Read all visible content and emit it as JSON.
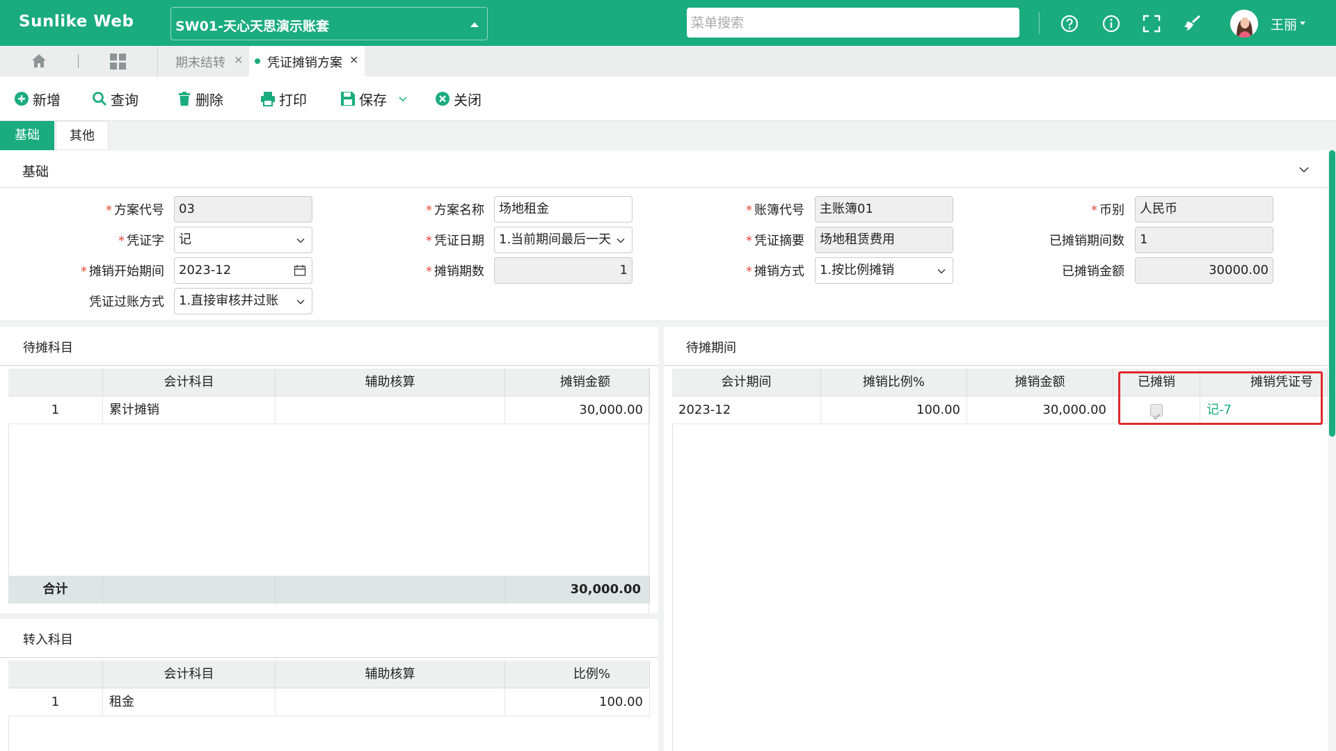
{
  "header": {
    "brand": "Sunlike Web",
    "account": "SW01-天心天思演示账套",
    "search_placeholder": "菜单搜索",
    "user": "王丽"
  },
  "tabs": {
    "inactive": "期末结转",
    "active": "凭证摊销方案",
    "close": "×"
  },
  "toolbar": {
    "add": "新增",
    "query": "查询",
    "delete": "删除",
    "print": "打印",
    "save": "保存",
    "close": "关闭"
  },
  "subtabs": {
    "basic": "基础",
    "other": "其他"
  },
  "section": {
    "title": "基础"
  },
  "form": {
    "scheme_code_label": "方案代号",
    "scheme_code": "03",
    "scheme_name_label": "方案名称",
    "scheme_name": "场地租金",
    "book_code_label": "账簿代号",
    "book_code": "主账簿01",
    "currency_label": "币别",
    "currency": "人民币",
    "voucher_word_label": "凭证字",
    "voucher_word": "记",
    "voucher_date_label": "凭证日期",
    "voucher_date": "1.当前期间最后一天",
    "voucher_summary_label": "凭证摘要",
    "voucher_summary": "场地租赁费用",
    "amortized_periods_label": "已摊销期间数",
    "amortized_periods": "1",
    "start_period_label": "摊销开始期间",
    "start_period": "2023-12",
    "period_count_label": "摊销期数",
    "period_count": "1",
    "method_label": "摊销方式",
    "method": "1.按比例摊销",
    "amortized_amount_label": "已摊销金额",
    "amortized_amount": "30000.00",
    "posting_label": "凭证过账方式",
    "posting": "1.直接审核并过账"
  },
  "pending_accounts": {
    "title": "待摊科目",
    "columns": [
      "会计科目",
      "辅助核算",
      "摊销金额"
    ],
    "rows": [
      {
        "no": "1",
        "account": "累计摊销",
        "aux": "",
        "amount": "30,000.00"
      }
    ],
    "total_label": "合计",
    "total_amount": "30,000.00"
  },
  "transfer_accounts": {
    "title": "转入科目",
    "columns": [
      "会计科目",
      "辅助核算",
      "比例%"
    ],
    "rows": [
      {
        "no": "1",
        "account": "租金",
        "aux": "",
        "ratio": "100.00"
      }
    ]
  },
  "pending_periods": {
    "title": "待摊期间",
    "columns": [
      "会计期间",
      "摊销比例%",
      "摊销金额",
      "已摊销",
      "摊销凭证号"
    ],
    "rows": [
      {
        "period": "2023-12",
        "ratio": "100.00",
        "amount": "30,000.00",
        "amortized": true,
        "voucher": "记-7"
      }
    ]
  },
  "colors": {
    "accent": "#1aac7d",
    "highlight": "#e0282a",
    "required": "#e5483b"
  }
}
